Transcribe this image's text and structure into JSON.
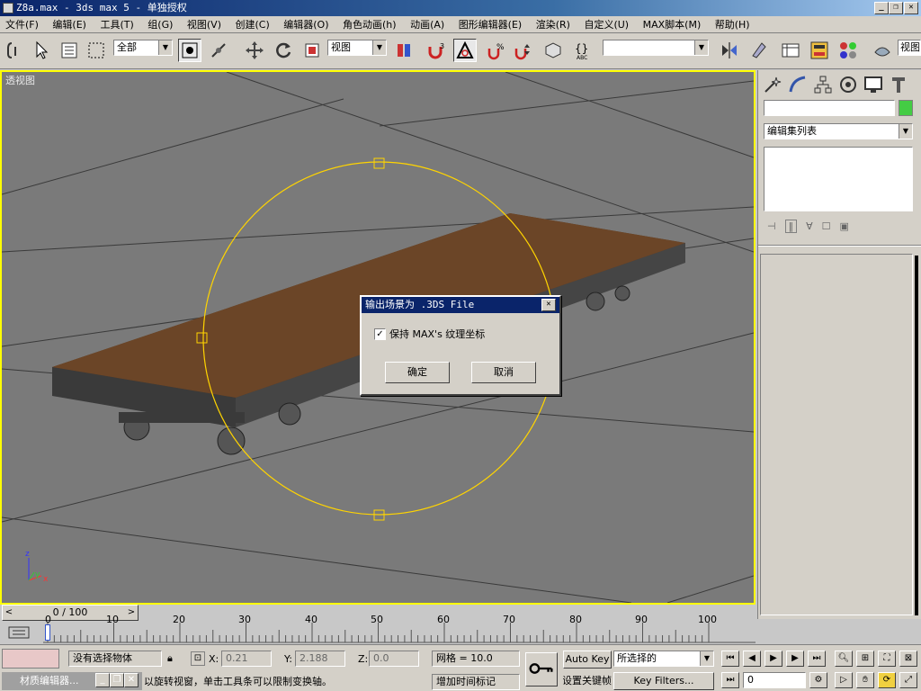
{
  "window": {
    "title": "Z8a.max - 3ds max 5 - 单独授权",
    "minimize": "_",
    "restore": "❐",
    "close": "✕"
  },
  "menu": [
    "文件(F)",
    "编辑(E)",
    "工具(T)",
    "组(G)",
    "视图(V)",
    "创建(C)",
    "编辑器(O)",
    "角色动画(h)",
    "动画(A)",
    "图形编辑器(E)",
    "渲染(R)",
    "自定义(U)",
    "MAX脚本(M)",
    "帮助(H)"
  ],
  "toolbar": {
    "selection_filter": "全部",
    "ref_coord": "视图",
    "named_selection": "",
    "right_label": "视图"
  },
  "viewport": {
    "label": "透视图",
    "axis_labels": {
      "z": "z",
      "y": "y",
      "x": "x"
    }
  },
  "dialog": {
    "title": "输出场景为 .3DS File",
    "checkbox_label": "保持 MAX's 纹理坐标",
    "checkbox_checked": true,
    "ok": "确定",
    "cancel": "取消",
    "close": "✕"
  },
  "command_panel": {
    "name_field": "",
    "modifier_list": "编辑集列表",
    "color_swatch": "#44cc44"
  },
  "timeline": {
    "frame_label": "0 / 100",
    "prev": "<",
    "next": ">",
    "ticks": [
      "0",
      "10",
      "20",
      "30",
      "40",
      "50",
      "60",
      "70",
      "80",
      "90",
      "100"
    ]
  },
  "status": {
    "selection": "没有选择物体",
    "x_label": "X:",
    "x_value": "0.21",
    "y_label": "Y:",
    "y_value": "2.188",
    "z_label": "Z:",
    "z_value": "0.0",
    "grid": "网格 = 10.0",
    "prompt": "以旋转视窗，单击工具条可以限制变换轴。",
    "add_time_tag": "增加时间标记",
    "auto_key": "Auto Key",
    "set_key": "设置关键帧",
    "key_mode": "所选择的",
    "key_filters": "Key Filters...",
    "frame_value": "0",
    "material_editor_task": "材质编辑器..."
  }
}
